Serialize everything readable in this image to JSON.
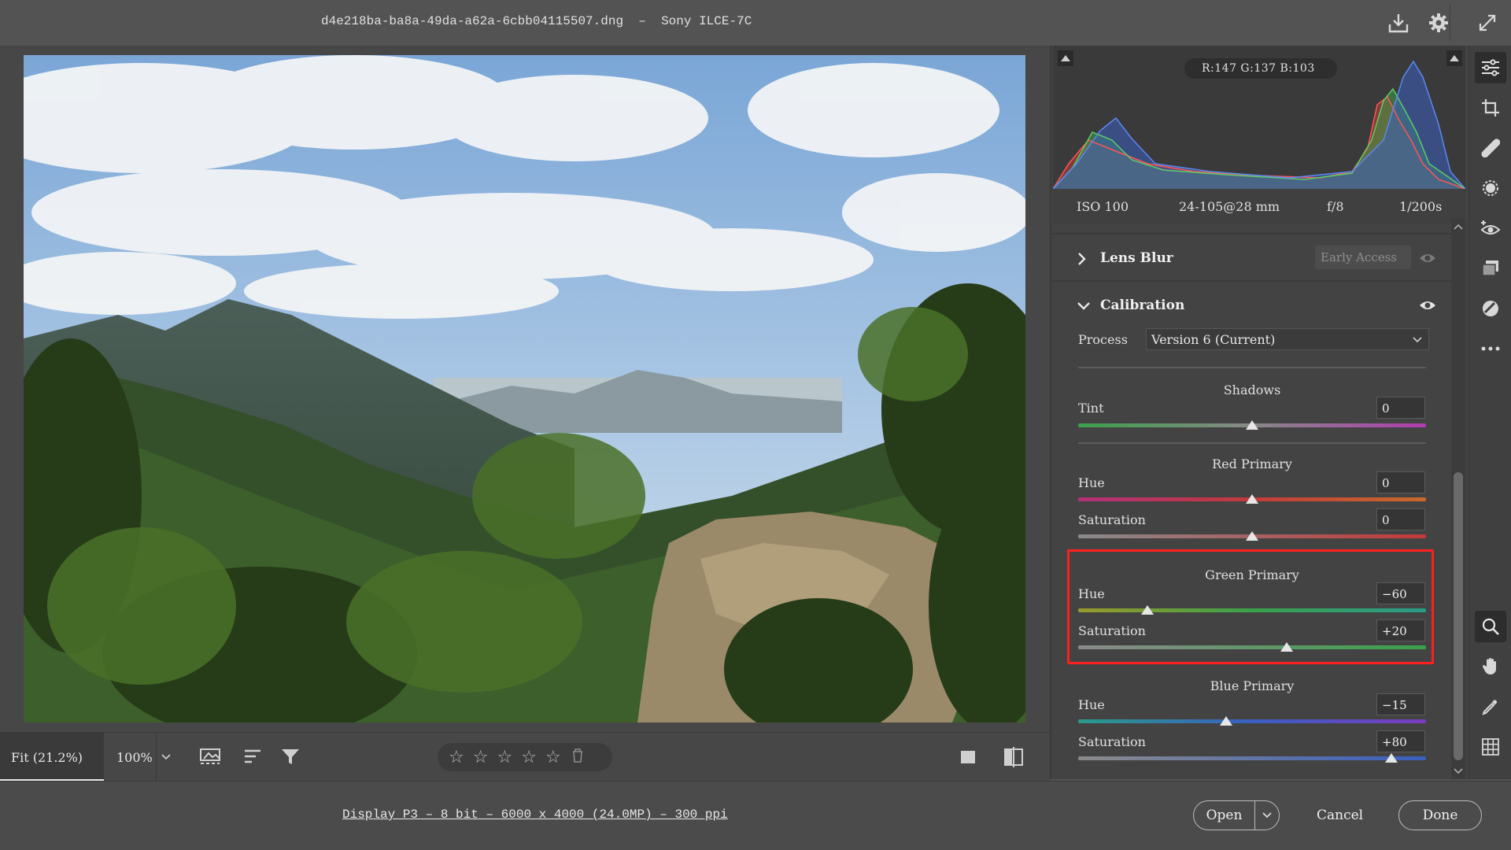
{
  "window": {
    "title": "d4e218ba-ba8a-49da-a62a-6cbb04115507.dng  –  Sony ILCE-7C"
  },
  "toolbar_icons": [
    "save-download-icon",
    "settings-gear-icon",
    "fullscreen-expand-icon"
  ],
  "histogram": {
    "rgb_readout": "R:147  G:137  B:103",
    "colors": {
      "red": "#d23b3b",
      "green": "#3fae4a",
      "blue": "#3a6fd8"
    }
  },
  "exif": {
    "iso": "ISO 100",
    "lens": "24-105@28 mm",
    "aperture": "f/8",
    "shutter": "1/200s"
  },
  "panel": {
    "lens_blur": {
      "title": "Lens Blur",
      "badge": "Early Access"
    },
    "calibration": {
      "title": "Calibration",
      "process_label": "Process",
      "process_value": "Version 6 (Current)",
      "shadows": {
        "heading": "Shadows",
        "tint_label": "Tint",
        "tint_value": "0",
        "tint_pos": 0.5
      },
      "red_primary": {
        "heading": "Red Primary",
        "hue_label": "Hue",
        "hue_value": "0",
        "hue_pos": 0.5,
        "sat_label": "Saturation",
        "sat_value": "0",
        "sat_pos": 0.5
      },
      "green_primary": {
        "heading": "Green Primary",
        "hue_label": "Hue",
        "hue_value": "−60",
        "hue_pos": 0.2,
        "sat_label": "Saturation",
        "sat_value": "+20",
        "sat_pos": 0.6
      },
      "blue_primary": {
        "heading": "Blue Primary",
        "hue_label": "Hue",
        "hue_value": "−15",
        "hue_pos": 0.425,
        "sat_label": "Saturation",
        "sat_value": "+80",
        "sat_pos": 0.9
      }
    }
  },
  "bottombar": {
    "zoom_fit": "Fit (21.2%)",
    "zoom_100": "100%",
    "rating_stars": 5
  },
  "footer": {
    "info_link": "Display P3 – 8 bit – 6000 x 4000 (24.0MP) – 300 ppi",
    "open_label": "Open",
    "cancel_label": "Cancel",
    "done_label": "Done"
  },
  "highlight_color": "#ff1f1f"
}
